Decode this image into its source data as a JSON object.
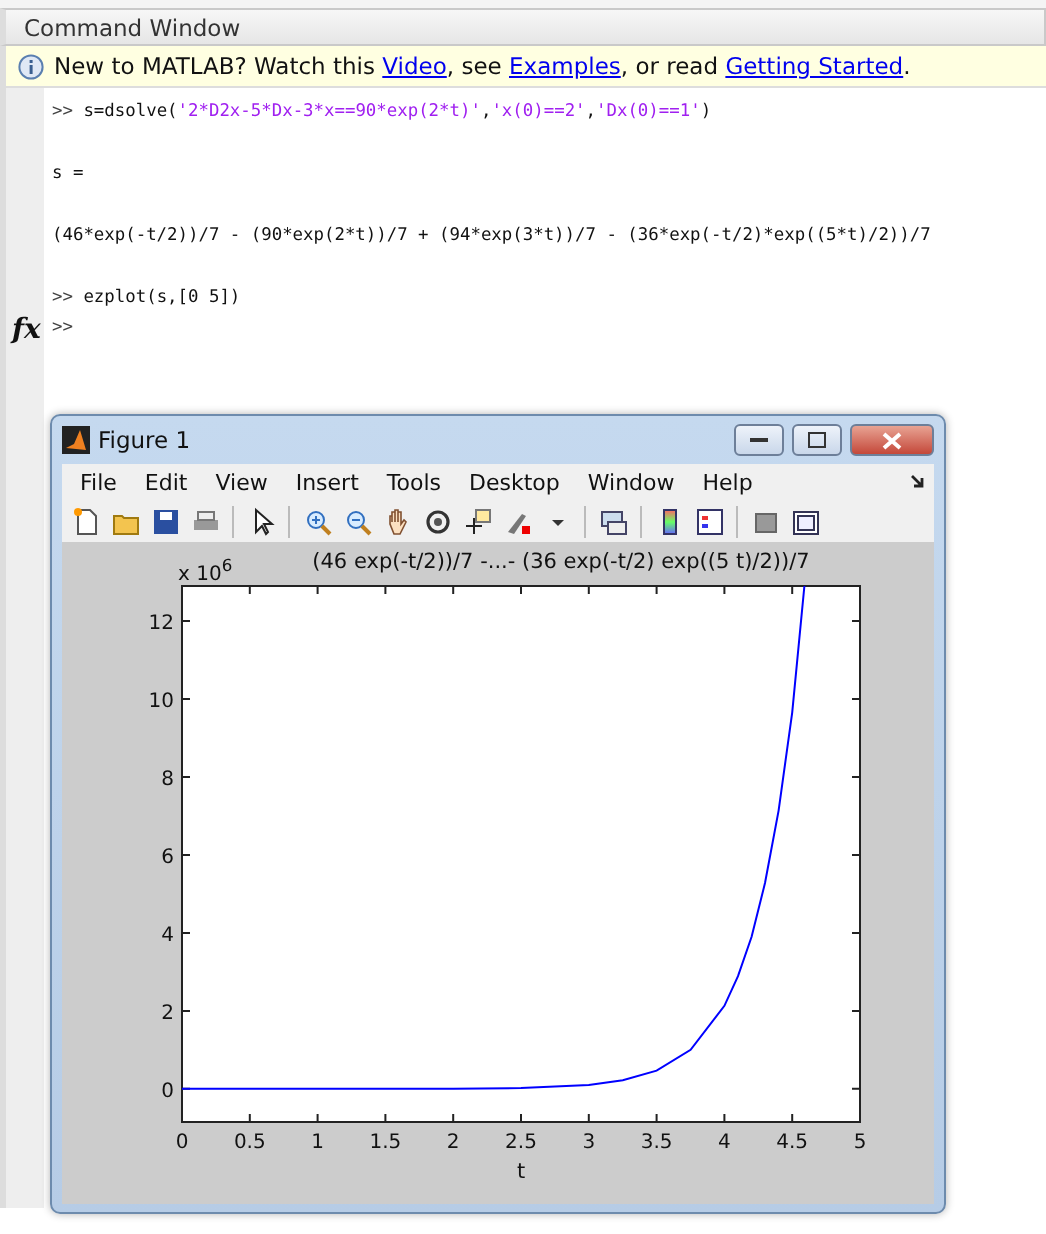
{
  "command_window": {
    "title": "Command Window",
    "notice": [
      {
        "kind": "text",
        "text": "New to MATLAB? Watch this "
      },
      {
        "kind": "link",
        "text": "Video"
      },
      {
        "kind": "text",
        "text": ", see "
      },
      {
        "kind": "link",
        "text": "Examples"
      },
      {
        "kind": "text",
        "text": ", or read "
      },
      {
        "kind": "link",
        "text": "Getting Started"
      },
      {
        "kind": "text",
        "text": "."
      }
    ],
    "lines": [
      {
        "kind": "command",
        "prompt": ">>",
        "segments": [
          {
            "kind": "code",
            "text": "s=dsolve("
          },
          {
            "kind": "string",
            "text": "'2*D2x-5*Dx-3*x==90*exp(2*t)'"
          },
          {
            "kind": "code",
            "text": ","
          },
          {
            "kind": "string",
            "text": "'x(0)==2'"
          },
          {
            "kind": "code",
            "text": ","
          },
          {
            "kind": "string",
            "text": "'Dx(0)==1'"
          },
          {
            "kind": "code",
            "text": ")"
          }
        ]
      },
      {
        "kind": "output",
        "text": "s ="
      },
      {
        "kind": "output",
        "text": "(46*exp(-t/2))/7 - (90*exp(2*t))/7 + (94*exp(3*t))/7 - (36*exp(-t/2)*exp((5*t)/2))/7"
      },
      {
        "kind": "command",
        "prompt": ">>",
        "segments": [
          {
            "kind": "code",
            "text": "ezplot(s,[0 5])"
          }
        ]
      }
    ],
    "current_prompt": {
      "fx": "fx",
      "prompt": ">>"
    }
  },
  "figure": {
    "title": "Figure 1",
    "menu": [
      "File",
      "Edit",
      "View",
      "Insert",
      "Tools",
      "Desktop",
      "Window",
      "Help"
    ],
    "axes": {
      "exponent": "x 10$^{6}$",
      "chart_data": {
        "type": "line",
        "title": "(46 exp(-t/2))/7 -...- (36 exp(-t/2) exp((5 t)/2))/7",
        "xlabel": "t",
        "x": [
          0,
          0.5,
          1,
          1.5,
          2,
          2.5,
          3,
          3.25,
          3.5,
          3.75,
          4,
          4.1,
          4.2,
          4.3,
          4.4,
          4.5,
          4.59
        ],
        "series": [
          {
            "color": "#0000ff",
            "values": [
              0,
              0,
              0,
              0,
              0,
              0.02,
              0.1,
              0.22,
              0.47,
              1.0,
              2.13,
              2.89,
              3.9,
              5.28,
              7.14,
              9.65,
              12.9
            ]
          }
        ],
        "xlim": [
          0,
          5
        ],
        "ylim": [
          -0.85,
          12.9
        ],
        "xticks": [
          {
            "value": 0,
            "label": "0"
          },
          {
            "value": 0.5,
            "label": "0.5"
          },
          {
            "value": 1,
            "label": "1"
          },
          {
            "value": 1.5,
            "label": "1.5"
          },
          {
            "value": 2,
            "label": "2"
          },
          {
            "value": 2.5,
            "label": "2.5"
          },
          {
            "value": 3,
            "label": "3"
          },
          {
            "value": 3.5,
            "label": "3.5"
          },
          {
            "value": 4,
            "label": "4"
          },
          {
            "value": 4.5,
            "label": "4.5"
          },
          {
            "value": 5,
            "label": "5"
          }
        ],
        "yticks": [
          {
            "value": 0,
            "label": "0"
          },
          {
            "value": 2,
            "label": "2"
          },
          {
            "value": 4,
            "label": "4"
          },
          {
            "value": 6,
            "label": "6"
          },
          {
            "value": 8,
            "label": "8"
          },
          {
            "value": 10,
            "label": "10"
          },
          {
            "value": 12,
            "label": "12"
          }
        ]
      }
    }
  }
}
